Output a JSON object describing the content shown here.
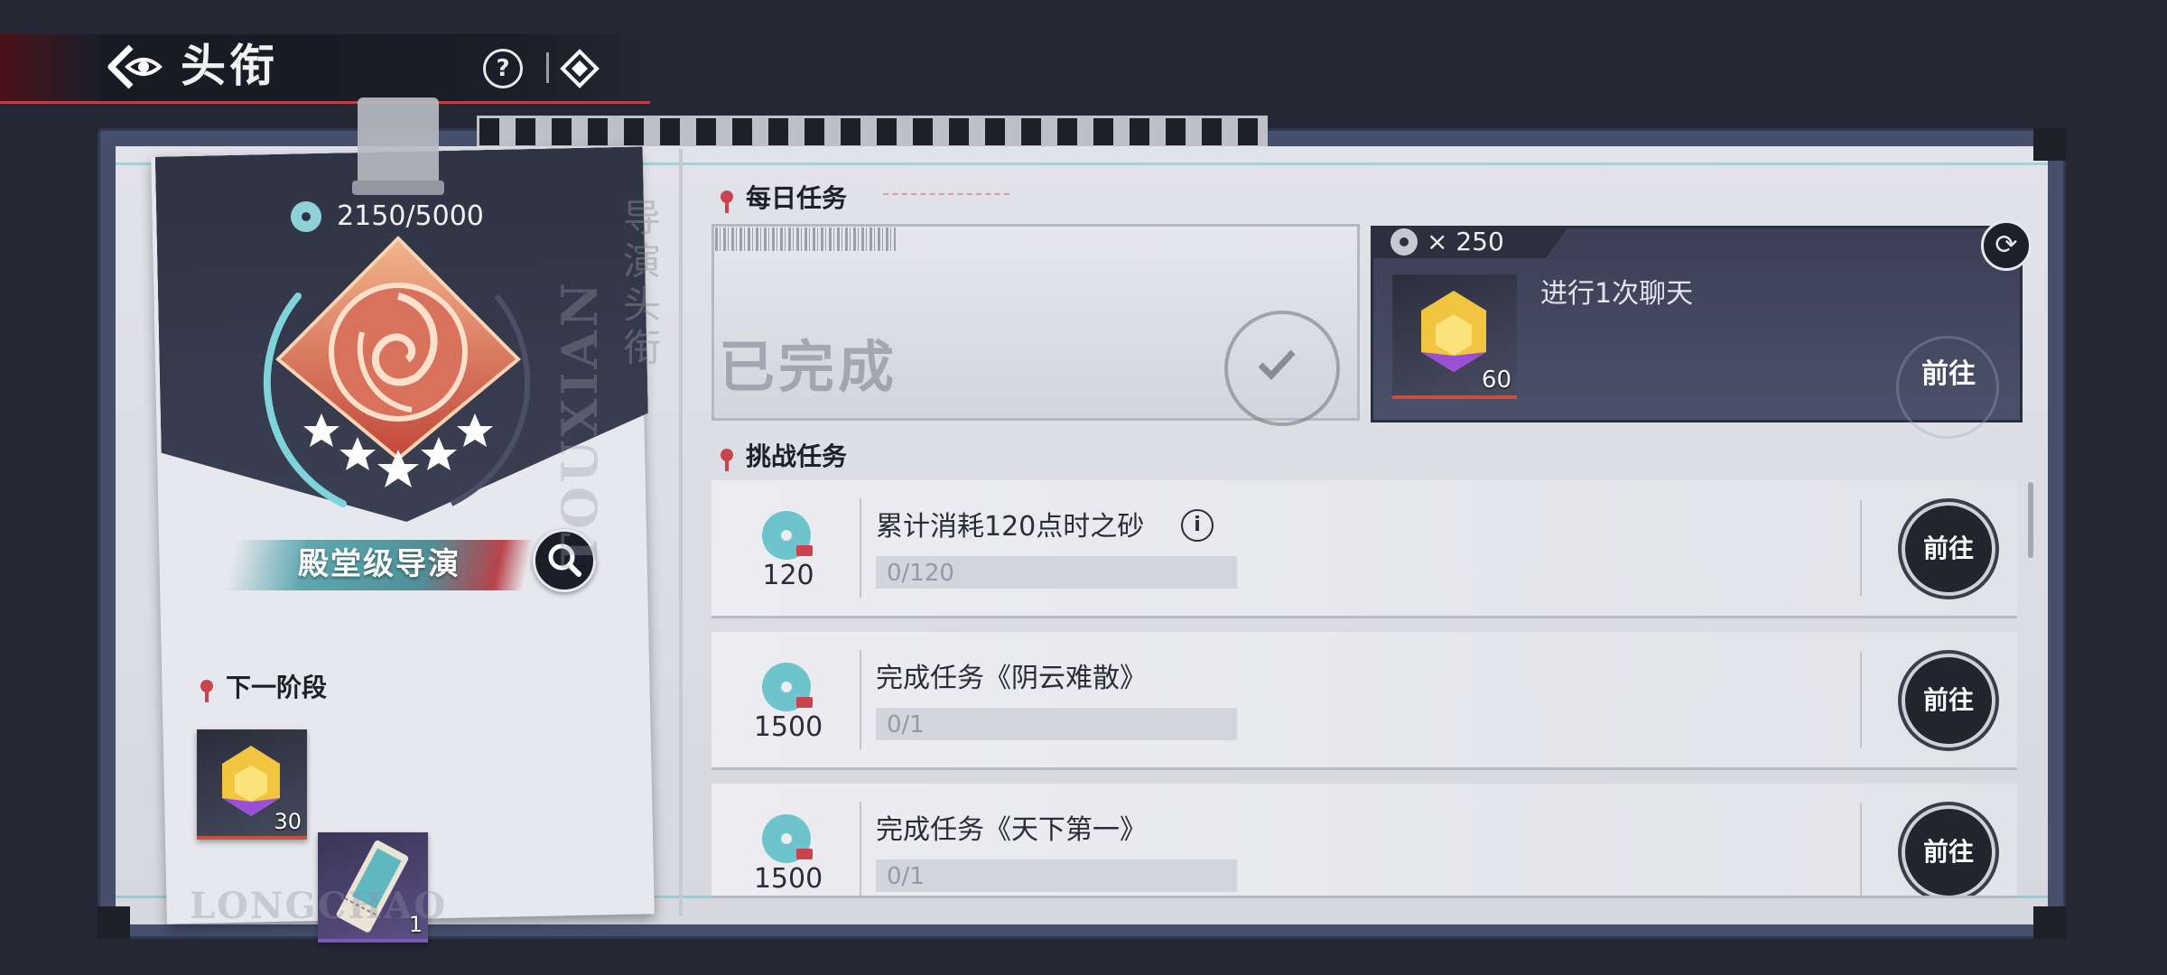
{
  "header": {
    "title": "头衔"
  },
  "rank_card": {
    "progress": "2150/5000",
    "progress_value": 2150,
    "progress_max": 5000,
    "rank_name": "殿堂级导演",
    "side_text": "导演头衔",
    "watermark_vertical": "TOUXIAN",
    "watermark_bottom": "LONGCHAO",
    "next_stage_title": "下一阶段",
    "next_items": [
      {
        "icon": "gem-icon",
        "count": "30"
      },
      {
        "icon": "ticket-icon",
        "count": "1"
      }
    ],
    "stars": 5
  },
  "daily": {
    "title": "每日任务",
    "completed_label": "已完成",
    "reward": "× 250",
    "task": "进行1次聊天",
    "item_count": "60",
    "go_label": "前往"
  },
  "challenge": {
    "title": "挑战任务",
    "tasks": [
      {
        "amount": "120",
        "name": "累计消耗120点时之砂",
        "progress": "0/120",
        "has_info": true,
        "go_label": "前往"
      },
      {
        "amount": "1500",
        "name": "完成任务《阴云难散》",
        "progress": "0/1",
        "has_info": false,
        "go_label": "前往"
      },
      {
        "amount": "1500",
        "name": "完成任务《天下第一》",
        "progress": "0/1",
        "has_info": false,
        "go_label": "前往"
      }
    ]
  },
  "colors": {
    "accent_red": "#c84550",
    "accent_teal": "#5ea8b0",
    "dark_panel": "#3a3f54"
  }
}
